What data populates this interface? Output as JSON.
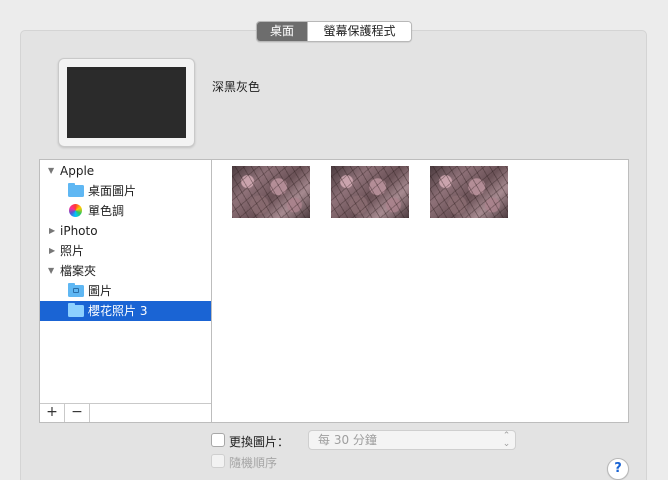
{
  "tabs": [
    {
      "label": "桌面",
      "active": true
    },
    {
      "label": "螢幕保護程式",
      "active": false
    }
  ],
  "preview": {
    "color_name": "深黑灰色",
    "color": "#2b2b2b"
  },
  "sidebar": {
    "items": [
      {
        "label": "Apple",
        "expanded": true
      },
      {
        "label": "桌面圖片"
      },
      {
        "label": "單色調"
      },
      {
        "label": "iPhoto",
        "expanded": false
      },
      {
        "label": "照片",
        "expanded": false
      },
      {
        "label": "檔案夾",
        "expanded": true
      },
      {
        "label": "圖片"
      },
      {
        "label": "櫻花照片 3",
        "selected": true
      }
    ],
    "toolbar": {
      "add": "+",
      "remove": "−"
    }
  },
  "thumbnails": [
    {
      "kind": "cherry-blossom"
    },
    {
      "kind": "cherry-blossom"
    },
    {
      "kind": "cherry-blossom"
    }
  ],
  "options": {
    "change_picture_label": "更換圖片：",
    "interval_value": "每 30 分鐘",
    "random_order_label": "隨機順序"
  },
  "help": {
    "label": "?"
  },
  "colors": {
    "accent": "#1a64d4",
    "folder": "#5fb7f3"
  }
}
